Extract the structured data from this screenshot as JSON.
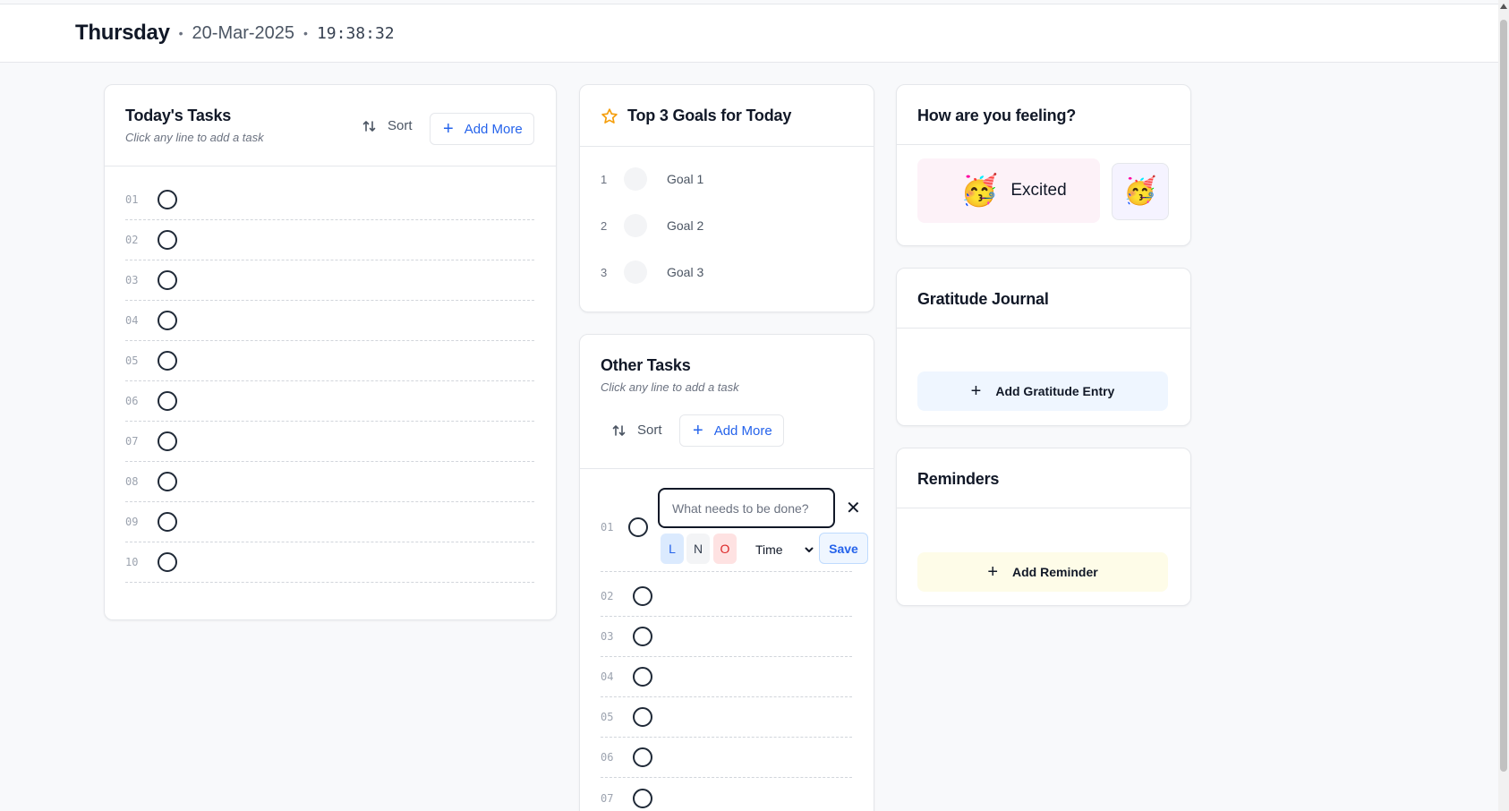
{
  "header": {
    "day": "Thursday",
    "separator": "•",
    "date": "20-Mar-2025",
    "time": "19:38:32"
  },
  "todays_tasks": {
    "title": "Today's Tasks",
    "subtitle": "Click any line to add a task",
    "sort_label": "Sort",
    "add_label": "Add More",
    "rows": [
      "01",
      "02",
      "03",
      "04",
      "05",
      "06",
      "07",
      "08",
      "09",
      "10"
    ]
  },
  "goals": {
    "title": "Top 3 Goals for Today",
    "items": [
      {
        "num": "1",
        "label": "Goal 1"
      },
      {
        "num": "2",
        "label": "Goal 2"
      },
      {
        "num": "3",
        "label": "Goal 3"
      }
    ]
  },
  "other_tasks": {
    "title": "Other Tasks",
    "subtitle": "Click any line to add a task",
    "sort_label": "Sort",
    "add_label": "Add More",
    "editing_row": "01",
    "input_placeholder": "What needs to be done?",
    "priorities": [
      "L",
      "N",
      "O"
    ],
    "time_label": "Time",
    "save_label": "Save",
    "rows": [
      "02",
      "03",
      "04",
      "05",
      "06",
      "07"
    ]
  },
  "mood": {
    "title": "How are you feeling?",
    "selected_label": "Excited",
    "emoji": "🥳"
  },
  "gratitude": {
    "title": "Gratitude Journal",
    "add_label": "Add Gratitude Entry"
  },
  "reminders": {
    "title": "Reminders",
    "add_label": "Add Reminder"
  },
  "colors": {
    "accent": "#2563eb",
    "star": "#f59e0b",
    "mood_bg": "#fdf2f8",
    "gratitude_bg": "#eff6ff",
    "reminder_bg": "#fefce8",
    "prio_low_bg": "#dbeafe",
    "prio_normal_bg": "#f3f4f6",
    "prio_overdue_bg": "#fee2e2"
  }
}
